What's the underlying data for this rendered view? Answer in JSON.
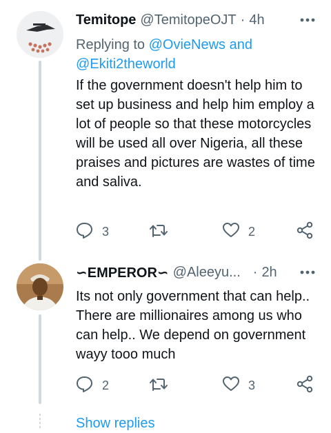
{
  "tweets": [
    {
      "name": "Temitope",
      "handle": "@TemitopeOJT",
      "separator": "·",
      "time": "4h",
      "reply_prefix": "Replying to",
      "reply_to_1": "@OvieNews",
      "reply_and": "and",
      "reply_to_2": "@Ekiti2theworld",
      "text": "If the government doesn't help him to set up business and help him employ a lot of people so that these motorcycles will be used all over Nigeria, all these praises and pictures are wastes of time and saliva.",
      "replies": "3",
      "retweets": "",
      "likes": "2"
    },
    {
      "name": "∽EMPEROR∽",
      "handle": "@Aleeyu...",
      "separator": "·",
      "time": "2h",
      "text": "Its not only government that can help.. There are millionaires among us who can help.. We depend on government wayy tooo much",
      "replies": "2",
      "retweets": "",
      "likes": "3"
    }
  ],
  "show_replies": "Show replies",
  "colors": {
    "text": "#0f1419",
    "secondary": "#536471",
    "link": "#1d9bf0",
    "thread_line": "#cfd9de"
  },
  "icons": {
    "reply": "reply-icon",
    "retweet": "retweet-icon",
    "like": "like-icon",
    "share": "share-icon",
    "more": "more-icon"
  }
}
